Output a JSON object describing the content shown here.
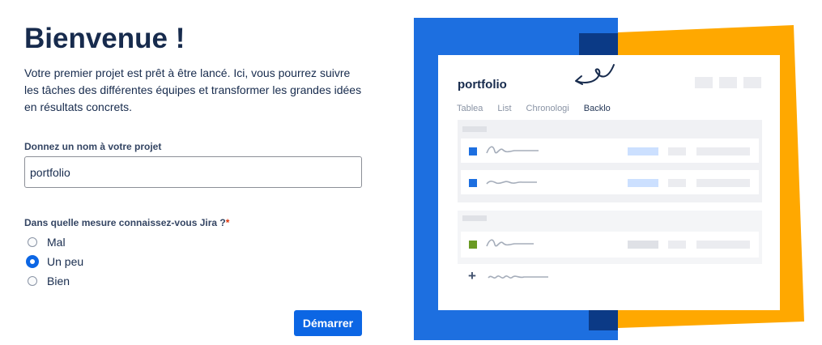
{
  "heading": "Bienvenue !",
  "intro": "Votre premier projet est prêt à être lancé. Ici, vous pourrez suivre les tâches des différentes équipes et transformer les grandes idées en résultats concrets.",
  "project_name": {
    "label": "Donnez un nom à votre projet",
    "value": "portfolio"
  },
  "experience": {
    "label": "Dans quelle mesure connaissez-vous Jira ?",
    "required_marker": "*",
    "options": [
      {
        "label": "Mal",
        "selected": false
      },
      {
        "label": "Un peu",
        "selected": true
      },
      {
        "label": "Bien",
        "selected": false
      }
    ]
  },
  "start_button": "Démarrer",
  "preview": {
    "title": "portfolio",
    "tabs": [
      "Tablea",
      "List",
      "Chronologi",
      "Backlo"
    ],
    "active_tab": "Backlo",
    "add_symbol": "+"
  },
  "colors": {
    "primary": "#0c66e4",
    "illustration_blue": "#1d6fe0",
    "illustration_navy": "#0b3a86",
    "illustration_yellow": "#ffa800",
    "issue_blue": "#1d6fe0",
    "issue_green": "#6a9a23",
    "required": "#de350b"
  }
}
